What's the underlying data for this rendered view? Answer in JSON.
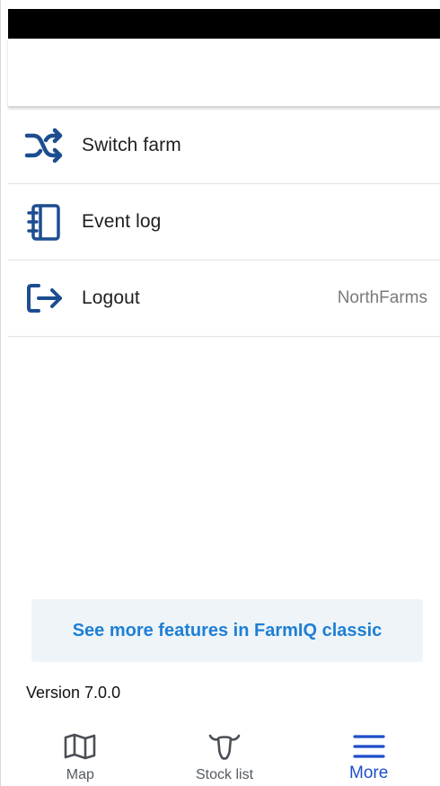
{
  "menu": {
    "items": [
      {
        "label": "Switch farm",
        "icon": "shuffle-icon",
        "trailing": ""
      },
      {
        "label": "Event log",
        "icon": "notebook-icon",
        "trailing": ""
      },
      {
        "label": "Logout",
        "icon": "logout-icon",
        "trailing": "NorthFarms"
      }
    ]
  },
  "classic_banner": {
    "label": "See more features in FarmIQ classic"
  },
  "version": {
    "text": "Version 7.0.0"
  },
  "tabbar": {
    "tabs": [
      {
        "label": "Map",
        "icon": "map-icon",
        "active": false
      },
      {
        "label": "Stock list",
        "icon": "cow-icon",
        "active": false
      },
      {
        "label": "More",
        "icon": "hamburger-menu-icon",
        "active": true
      }
    ]
  },
  "colors": {
    "icon_blue": "#1c4d8f",
    "link_blue": "#1f7fd4",
    "active_tab": "#1e4fc9",
    "banner_bg": "#eef4f8"
  }
}
